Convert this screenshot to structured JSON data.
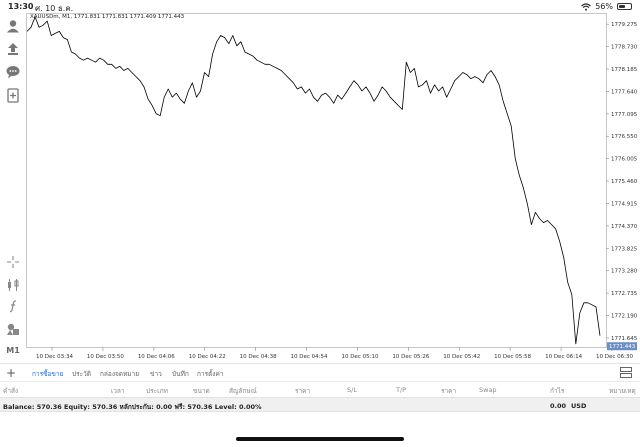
{
  "status_bar": {
    "time": "13:30",
    "date": "ศ. 10 ธ.ค.",
    "battery_text": "56%",
    "battery_level": 0.56
  },
  "toolbar": {
    "icons": [
      "account-icon",
      "trade-icon",
      "chat-icon",
      "new-order-icon",
      "crosshair-icon",
      "indicators-icon",
      "function-icon",
      "objects-icon"
    ],
    "timeframe": "M1"
  },
  "chart": {
    "title": "XAUUSDm, M1, 1771.831 1771.831 1771.409 1771.443",
    "current_price_label": "1771.443",
    "line_color": "#000000",
    "price_tag_bg": "#6b8fc4"
  },
  "chart_data": {
    "type": "line",
    "title": "XAUUSDm, M1, 1771.831 1771.831 1771.409 1771.443",
    "xlabel": "",
    "ylabel": "",
    "ylim": [
      1771.4,
      1779.45
    ],
    "grid": false,
    "y_ticks": [
      "1779.275",
      "1778.730",
      "1778.185",
      "1777.640",
      "1777.095",
      "1776.550",
      "1776.005",
      "1775.460",
      "1774.915",
      "1774.370",
      "1773.825",
      "1773.280",
      "1772.735",
      "1772.190",
      "1771.645"
    ],
    "x_ticks": [
      "10 Dec 03:34",
      "10 Dec 03:50",
      "10 Dec 04:06",
      "10 Dec 04:22",
      "10 Dec 04:38",
      "10 Dec 04:54",
      "10 Dec 05:10",
      "10 Dec 05:26",
      "10 Dec 05:42",
      "10 Dec 05:58",
      "10 Dec 06:14",
      "10 Dec 06:30"
    ],
    "series": [
      {
        "values": [
          1779.1,
          1779.2,
          1779.45,
          1779.2,
          1779.25,
          1779.35,
          1779.0,
          1779.05,
          1779.1,
          1778.95,
          1778.9,
          1778.6,
          1778.55,
          1778.45,
          1778.4,
          1778.45,
          1778.4,
          1778.35,
          1778.45,
          1778.4,
          1778.3,
          1778.3,
          1778.2,
          1778.25,
          1778.15,
          1778.2,
          1778.1,
          1778.0,
          1777.9,
          1777.75,
          1777.45,
          1777.3,
          1777.1,
          1777.05,
          1777.5,
          1777.7,
          1777.5,
          1777.6,
          1777.45,
          1777.35,
          1777.65,
          1777.85,
          1777.5,
          1777.65,
          1778.1,
          1778.0,
          1778.55,
          1778.85,
          1779.0,
          1778.95,
          1778.8,
          1779.0,
          1778.75,
          1778.85,
          1778.6,
          1778.55,
          1778.5,
          1778.4,
          1778.35,
          1778.3,
          1778.3,
          1778.25,
          1778.2,
          1778.15,
          1778.05,
          1777.95,
          1777.85,
          1777.7,
          1777.75,
          1777.6,
          1777.7,
          1777.5,
          1777.4,
          1777.55,
          1777.6,
          1777.5,
          1777.35,
          1777.55,
          1777.45,
          1777.6,
          1777.75,
          1777.9,
          1777.8,
          1777.65,
          1777.75,
          1777.6,
          1777.4,
          1777.55,
          1777.75,
          1777.65,
          1777.5,
          1777.4,
          1777.3,
          1777.2,
          1778.35,
          1778.1,
          1778.2,
          1777.75,
          1777.8,
          1777.9,
          1777.6,
          1777.8,
          1777.65,
          1777.75,
          1777.5,
          1777.7,
          1777.9,
          1778.0,
          1778.1,
          1778.05,
          1777.95,
          1778.0,
          1777.95,
          1777.85,
          1778.05,
          1778.15,
          1778.0,
          1777.8,
          1777.4,
          1777.1,
          1776.8,
          1776.0,
          1775.6,
          1775.3,
          1774.9,
          1774.4,
          1774.7,
          1774.55,
          1774.45,
          1774.5,
          1774.4,
          1774.3,
          1774.0,
          1773.6,
          1773.0,
          1772.7,
          1771.5,
          1772.25,
          1772.5,
          1772.5,
          1772.45,
          1772.4,
          1771.7
        ]
      }
    ]
  },
  "tabs": [
    {
      "label": "การซื้อขาย",
      "active": true
    },
    {
      "label": "ประวัติ",
      "active": false
    },
    {
      "label": "กล่องจดหมาย",
      "active": false
    },
    {
      "label": "ข่าว",
      "active": false
    },
    {
      "label": "บันทึก",
      "active": false
    },
    {
      "label": "การตั้งค่า",
      "active": false
    }
  ],
  "columns": [
    "คำสั่ง",
    "เวลา",
    "ประเภท",
    "ขนาด",
    "สัญลักษณ์",
    "ราคา",
    "S/L",
    "T/P",
    "ราคา",
    "Swap",
    "กำไร",
    "หมายเหตุ"
  ],
  "balance": {
    "text": "Balance: 570.36 Equity: 570.36 หลักประกัน: 0.00 ฟรี: 570.36 Level: 0.00%",
    "profit": "0.00",
    "currency": "USD"
  }
}
